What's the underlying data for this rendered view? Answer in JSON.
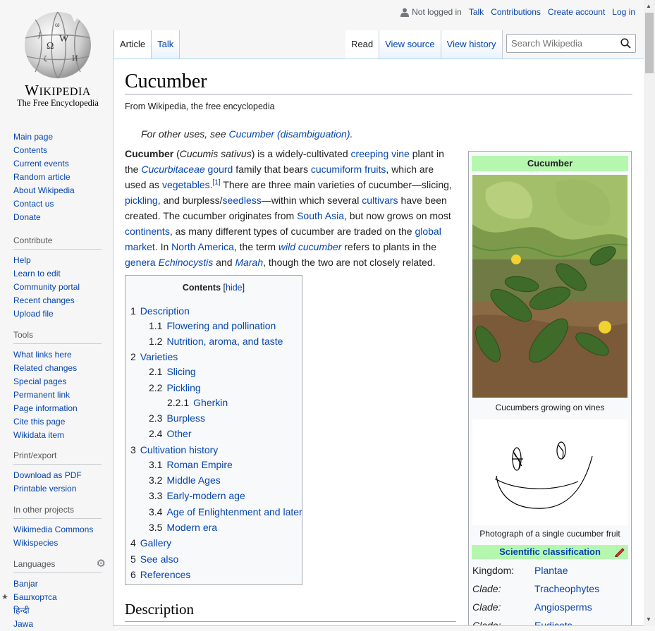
{
  "logo": {
    "wordmark": "Wikipedia",
    "tagline": "The Free Encyclopedia"
  },
  "user_bar": {
    "not_logged_in": "Not logged in",
    "talk": "Talk",
    "contributions": "Contributions",
    "create_account": "Create account",
    "login": "Log in"
  },
  "nav_tabs": {
    "article": "Article",
    "talk": "Talk",
    "read": "Read",
    "view_source": "View source",
    "view_history": "View history"
  },
  "search": {
    "placeholder": "Search Wikipedia"
  },
  "sidebar": {
    "main": [
      "Main page",
      "Contents",
      "Current events",
      "Random article",
      "About Wikipedia",
      "Contact us",
      "Donate"
    ],
    "contribute": {
      "heading": "Contribute",
      "items": [
        "Help",
        "Learn to edit",
        "Community portal",
        "Recent changes",
        "Upload file"
      ]
    },
    "tools": {
      "heading": "Tools",
      "items": [
        "What links here",
        "Related changes",
        "Special pages",
        "Permanent link",
        "Page information",
        "Cite this page",
        "Wikidata item"
      ]
    },
    "print": {
      "heading": "Print/export",
      "items": [
        "Download as PDF",
        "Printable version"
      ]
    },
    "projects": {
      "heading": "In other projects",
      "items": [
        "Wikimedia Commons",
        "Wikispecies"
      ]
    },
    "languages": {
      "heading": "Languages",
      "items": [
        "Banjar",
        "Башҡортса",
        "हिन्दी",
        "Jawa"
      ]
    }
  },
  "article": {
    "title": "Cucumber",
    "tagline": "From Wikipedia, the free encyclopedia",
    "hatnote_prefix": "For other uses, see ",
    "hatnote_link": "Cucumber (disambiguation)",
    "lead": {
      "t1": "Cucumber",
      "t2": " (",
      "t3": "Cucumis sativus",
      "t4": ") is a widely-cultivated ",
      "l1": "creeping vine",
      "t5": " plant in the ",
      "l2": "Cucurbitaceae",
      "t6": " ",
      "l3": "gourd",
      "t7": " family that bears ",
      "l4": "cucumiform fruits",
      "t8": ", which are used as ",
      "l5": "vegetables",
      "ref": "[1]",
      "t9": " There are three main varieties of cucumber—slicing, ",
      "l6": "pickling",
      "t10": ", and burpless/",
      "l7": "seedless",
      "t11": "—within which several ",
      "l8": "cultivars",
      "t12": " have been created. The cucumber originates from ",
      "l9": "South Asia",
      "t13": ", but now grows on most ",
      "l10": "continents",
      "t14": ", as many different types of cucumber are traded on the ",
      "l11": "global market",
      "t15": ". In ",
      "l12": "North America",
      "t16": ", the term ",
      "l13": "wild cucumber",
      "t17": " refers to plants in the ",
      "l14": "genera",
      "t18": " ",
      "l15": "Echinocystis",
      "t19": " and ",
      "l16": "Marah",
      "t20": ", though the two are not closely related."
    },
    "section_heading": "Description"
  },
  "toc": {
    "title": "Contents",
    "hide": "hide",
    "items": [
      {
        "num": "1",
        "label": "Description"
      },
      {
        "num": "1.1",
        "label": "Flowering and pollination"
      },
      {
        "num": "1.2",
        "label": "Nutrition, aroma, and taste"
      },
      {
        "num": "2",
        "label": "Varieties"
      },
      {
        "num": "2.1",
        "label": "Slicing"
      },
      {
        "num": "2.2",
        "label": "Pickling"
      },
      {
        "num": "2.2.1",
        "label": "Gherkin"
      },
      {
        "num": "2.3",
        "label": "Burpless"
      },
      {
        "num": "2.4",
        "label": "Other"
      },
      {
        "num": "3",
        "label": "Cultivation history"
      },
      {
        "num": "3.1",
        "label": "Roman Empire"
      },
      {
        "num": "3.2",
        "label": "Middle Ages"
      },
      {
        "num": "3.3",
        "label": "Early-modern age"
      },
      {
        "num": "3.4",
        "label": "Age of Enlightenment and later"
      },
      {
        "num": "3.5",
        "label": "Modern era"
      },
      {
        "num": "4",
        "label": "Gallery"
      },
      {
        "num": "5",
        "label": "See also"
      },
      {
        "num": "6",
        "label": "References"
      }
    ]
  },
  "infobox": {
    "title": "Cucumber",
    "caption1": "Cucumbers growing on vines",
    "caption2": "Photograph of a single cucumber fruit",
    "sci_heading": "Scientific classification",
    "taxonomy": [
      {
        "rank": "Kingdom:",
        "value": "Plantae"
      },
      {
        "rank": "Clade:",
        "value": "Tracheophytes"
      },
      {
        "rank": "Clade:",
        "value": "Angiosperms"
      },
      {
        "rank": "Clade:",
        "value": "Eudicots"
      }
    ]
  }
}
